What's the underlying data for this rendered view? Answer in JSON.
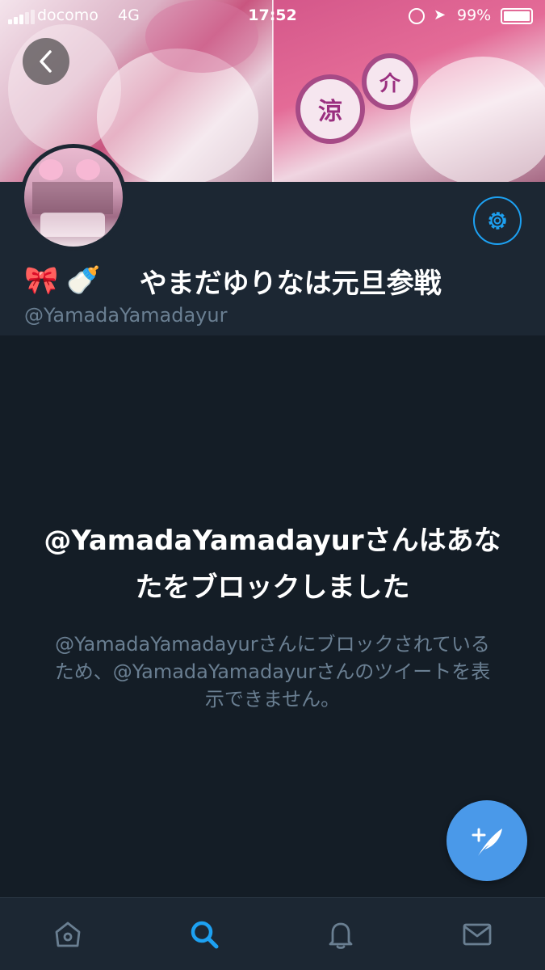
{
  "status_bar": {
    "carrier": "docomo",
    "network": "4G",
    "time": "17:52",
    "battery": "99%"
  },
  "profile": {
    "display_name": "やまだゆりなは元旦参戦",
    "name_emojis": [
      "🎀",
      "🍼"
    ],
    "handle": "@YamadaYamadayur"
  },
  "blocked": {
    "title": "@YamadaYamadayurさんはあなたをブロックしました",
    "description": "@YamadaYamadayurさんにブロックされているため、@YamadaYamadayurさんのツイートを表示できません。"
  },
  "banner": {
    "uchiwa_texts": [
      "涼",
      "介"
    ]
  },
  "tabs": [
    {
      "icon": "home-icon",
      "active": false
    },
    {
      "icon": "search-icon",
      "active": true
    },
    {
      "icon": "bell-icon",
      "active": false
    },
    {
      "icon": "mail-icon",
      "active": false
    }
  ],
  "colors": {
    "accent": "#1da1f2",
    "background": "#141d26",
    "header_bg": "#1c2733",
    "secondary_text": "#6a7f92",
    "fab": "#4a99e9"
  }
}
